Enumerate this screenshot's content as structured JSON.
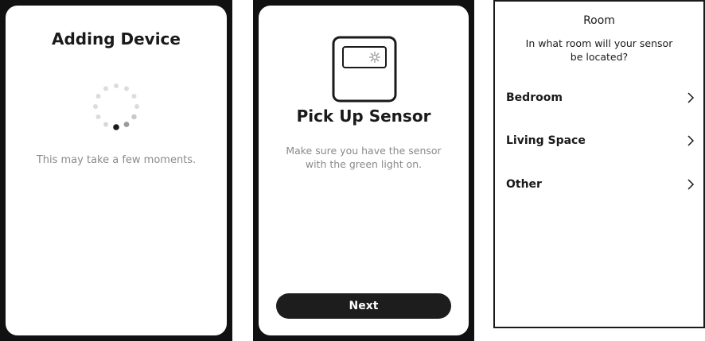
{
  "screen1": {
    "title": "Adding Device",
    "message": "This may take a few moments."
  },
  "screen2": {
    "title": "Pick Up Sensor",
    "description_line1": "Make sure you have the sensor",
    "description_line2": "with the green light on.",
    "next_label": "Next"
  },
  "screen3": {
    "header": "Room",
    "question_line1": "In what room will your sensor",
    "question_line2": "be located?",
    "options": [
      "Bedroom",
      "Living Space",
      "Other"
    ]
  },
  "icons": {
    "spinner": "loading-spinner-icon",
    "sensor": "sensor-device-icon",
    "chevron": "chevron-right-icon"
  }
}
